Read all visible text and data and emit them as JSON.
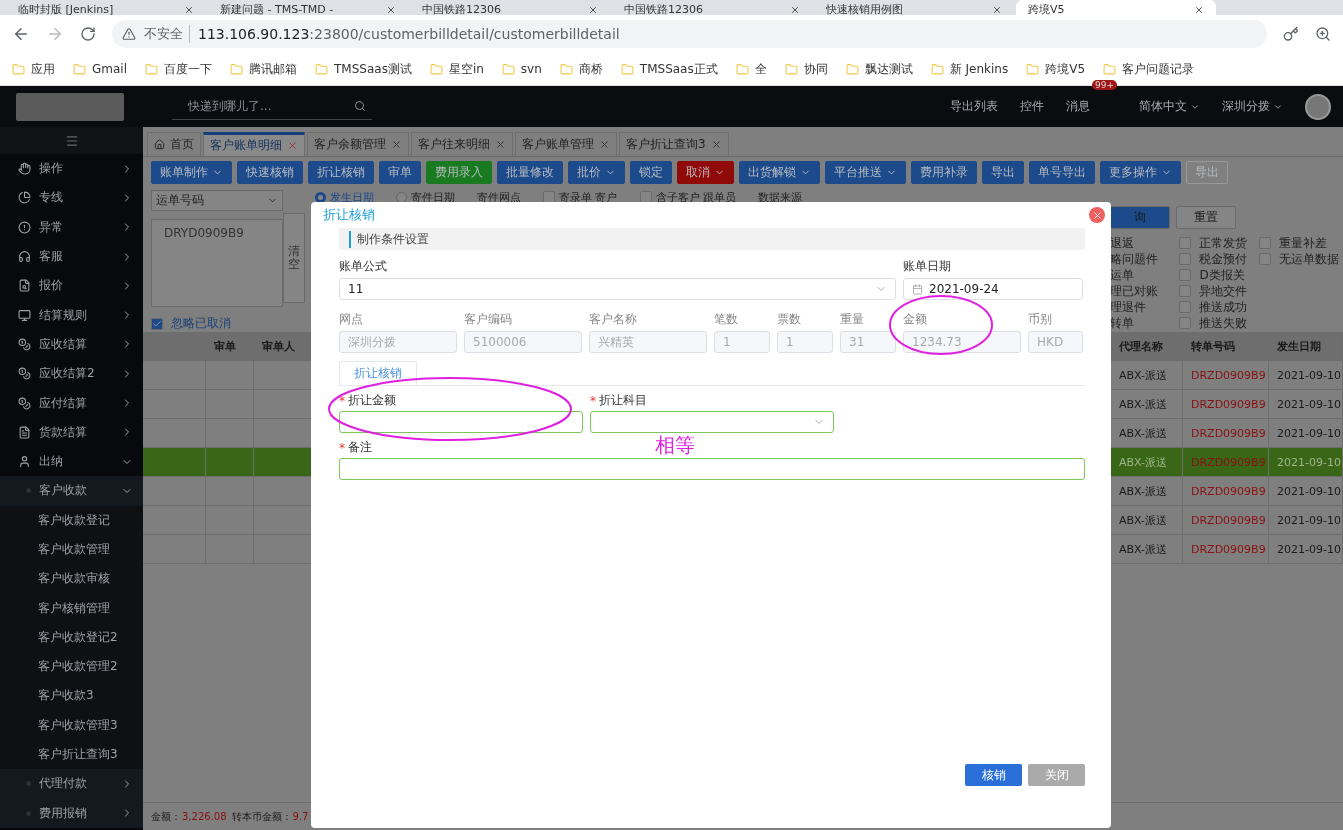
{
  "browser": {
    "tabs": [
      {
        "title": "临时封版 [Jenkins]",
        "selected": false
      },
      {
        "title": "新建问题 - TMS-TMD -",
        "selected": false
      },
      {
        "title": "中国铁路12306",
        "selected": false
      },
      {
        "title": "中国铁路12306",
        "selected": false
      },
      {
        "title": "快速核销用例图",
        "selected": false
      },
      {
        "title": "跨境V5",
        "selected": true
      }
    ],
    "security": "不安全",
    "url_host": "113.106.90.123",
    "url_path": ":23800/customerbilldetail/customerbilldetail",
    "bookmarks": [
      "应用",
      "Gmail",
      "百度一下",
      "腾讯邮箱",
      "TMSSaas测试",
      "星空in",
      "svn",
      "商桥",
      "TMSSaas正式",
      "全",
      "协同",
      "飘达测试",
      "新 Jenkins",
      "跨境V5",
      "客户问题记录"
    ]
  },
  "header": {
    "search_placeholder": "快递到哪儿了...",
    "links": [
      "导出列表",
      "控件"
    ],
    "messages": "消息",
    "badge": "99+",
    "language": "简体中文",
    "branch": "深圳分拨"
  },
  "sidebar": {
    "items": [
      {
        "label": "操作",
        "expanded": false
      },
      {
        "label": "专线",
        "expanded": false
      },
      {
        "label": "异常",
        "expanded": false
      },
      {
        "label": "客服",
        "expanded": false
      },
      {
        "label": "报价",
        "expanded": false
      },
      {
        "label": "结算规则",
        "expanded": false
      },
      {
        "label": "应收结算",
        "expanded": false
      },
      {
        "label": "应收结算2",
        "expanded": false
      },
      {
        "label": "应付结算",
        "expanded": false
      },
      {
        "label": "货款结算",
        "expanded": false
      },
      {
        "label": "出纳",
        "expanded": true,
        "children": [
          {
            "label": "客户收款",
            "expanded": true,
            "children": [
              {
                "label": "客户收款登记"
              },
              {
                "label": "客户收款管理"
              },
              {
                "label": "客户收款审核"
              },
              {
                "label": "客户核销管理"
              },
              {
                "label": "客户收款登记2"
              },
              {
                "label": "客户收款管理2"
              },
              {
                "label": "客户收款3"
              },
              {
                "label": "客户收款管理3"
              },
              {
                "label": "客户折让查询3"
              }
            ]
          },
          {
            "label": "代理付款",
            "expanded": false
          },
          {
            "label": "费用报销",
            "expanded": false
          }
        ]
      }
    ]
  },
  "tabs": [
    {
      "label": "首页",
      "kind": "home",
      "selected": false
    },
    {
      "label": "客户账单明细",
      "kind": "page",
      "selected": true
    },
    {
      "label": "客户余额管理",
      "kind": "page",
      "selected": false
    },
    {
      "label": "客户往来明细",
      "kind": "page",
      "selected": false
    },
    {
      "label": "客户账单管理",
      "kind": "page",
      "selected": false
    },
    {
      "label": "客户折让查询3",
      "kind": "page",
      "selected": false
    }
  ],
  "toolbar": [
    {
      "label": "账单制作",
      "dropdown": true,
      "color": "#1c4a8a"
    },
    {
      "label": "快速核销",
      "dropdown": false,
      "color": "#1c4a8a"
    },
    {
      "label": "折让核销",
      "dropdown": false,
      "color": "#1c4a8a"
    },
    {
      "label": "审单",
      "dropdown": false,
      "color": "#1c4a8a"
    },
    {
      "label": "费用录入",
      "dropdown": false,
      "color": "#1a7a22"
    },
    {
      "label": "批量修改",
      "dropdown": false,
      "color": "#1c4a8a"
    },
    {
      "label": "批价",
      "dropdown": true,
      "color": "#1c4a8a"
    },
    {
      "label": "锁定",
      "dropdown": false,
      "color": "#1c4a8a"
    },
    {
      "label": "取消",
      "dropdown": true,
      "color": "#900a0a"
    },
    {
      "label": "出货解锁",
      "dropdown": true,
      "color": "#1c4a8a"
    },
    {
      "label": "平台推送",
      "dropdown": true,
      "color": "#1c4a8a"
    },
    {
      "label": "费用补录",
      "dropdown": false,
      "color": "#1c4a8a"
    },
    {
      "label": "导出",
      "dropdown": false,
      "color": "#1c4a8a"
    },
    {
      "label": "单号导出",
      "dropdown": false,
      "color": "#1c4a8a"
    },
    {
      "label": "更多操作",
      "dropdown": true,
      "color": "#1c4a8a"
    },
    {
      "label": "导出",
      "dropdown": false,
      "color": "#808080"
    }
  ],
  "filters": {
    "search_type": "运单号码",
    "waybill_numbers": "DRYD0909B9",
    "clear": "清空",
    "ignore_cancelled": {
      "label": "忽略已取消",
      "checked": true
    },
    "top_row": [
      {
        "kind": "radio",
        "label": "发生日期",
        "selected": true
      },
      {
        "kind": "radio",
        "label": "寄件日期",
        "selected": false
      },
      {
        "kind": "text",
        "label": "寄件网点"
      },
      {
        "kind": "checkbox",
        "label": "寄录单 寄户",
        "checked": false
      },
      {
        "kind": "checkbox",
        "label": "含子客户 跟单员",
        "checked": false
      },
      {
        "kind": "text",
        "label": "数据来源"
      }
    ],
    "query": "询",
    "reset": "重置",
    "flag_columns": [
      [
        {
          "label": "退返"
        },
        {
          "label": "略问题件"
        },
        {
          "label": "运单"
        },
        {
          "label": "理已对账"
        },
        {
          "label": "理退件"
        },
        {
          "label": "转单"
        }
      ],
      [
        {
          "label": "正常发货",
          "checked": false
        },
        {
          "label": "税金预付",
          "checked": false
        },
        {
          "label": "D类报关",
          "checked": false
        },
        {
          "label": "异地交件",
          "checked": false
        },
        {
          "label": "推送成功",
          "checked": false
        },
        {
          "label": "推送失败",
          "checked": false
        }
      ],
      [
        {
          "label": "重量补差",
          "checked": false
        },
        {
          "label": "无运单数据",
          "checked": false
        }
      ]
    ]
  },
  "table": {
    "columns_left": [
      "审单",
      "审单人"
    ],
    "columns_right": [
      "代理名称",
      "转单号码",
      "发生日期"
    ],
    "rows": [
      {
        "selected": false,
        "agent": "ABX-派送",
        "transfer_no": "DRZD0909B9",
        "date": "2021-09-10"
      },
      {
        "selected": false,
        "agent": "ABX-派送",
        "transfer_no": "DRZD0909B9",
        "date": "2021-09-10"
      },
      {
        "selected": false,
        "agent": "ABX-派送",
        "transfer_no": "DRZD0909B9",
        "date": "2021-09-10"
      },
      {
        "selected": true,
        "agent": "ABX-派送",
        "transfer_no": "DRZD0909B9",
        "date": "2021-09-10"
      },
      {
        "selected": false,
        "agent": "ABX-派送",
        "transfer_no": "DRZD0909B9",
        "date": "2021-09-10"
      },
      {
        "selected": false,
        "agent": "ABX-派送",
        "transfer_no": "DRZD0909B9",
        "date": "2021-09-10"
      },
      {
        "selected": false,
        "agent": "ABX-派送",
        "transfer_no": "DRZD0909B9",
        "date": "2021-09-10"
      }
    ]
  },
  "footer": {
    "amount_label": "金额：",
    "amount": "3,226.08",
    "converted_label": "转本币金额：",
    "converted": "9.7"
  },
  "dialog": {
    "title": "折让核销",
    "section": "制作条件设置",
    "formula": {
      "label": "账单公式",
      "value": "11"
    },
    "bill_date": {
      "label": "账单日期",
      "value": "2021-09-24"
    },
    "info_fields": [
      {
        "label": "网点",
        "value": "深圳分拨"
      },
      {
        "label": "客户编码",
        "value": "5100006"
      },
      {
        "label": "客户名称",
        "value": "兴精英"
      },
      {
        "label": "笔数",
        "value": "1"
      },
      {
        "label": "票数",
        "value": "1"
      },
      {
        "label": "重量",
        "value": "31"
      },
      {
        "label": "金额",
        "value": "1234.73"
      },
      {
        "label": "币别",
        "value": "HKD"
      }
    ],
    "tab": "折让核销",
    "discount_amount": {
      "label": "折让金额",
      "required_mark": "*"
    },
    "discount_subject": {
      "label": "折让科目",
      "required_mark": "*"
    },
    "remark": {
      "label": "备注",
      "required_mark": "*"
    },
    "annotation": "相等",
    "buttons": [
      {
        "label": "核销",
        "kind": "primary"
      },
      {
        "label": "关闭",
        "kind": "secondary"
      }
    ]
  }
}
